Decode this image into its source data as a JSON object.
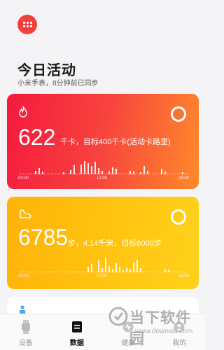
{
  "header": {
    "title": "今日活动",
    "sync_status": "小米手表，8分钟前已同步"
  },
  "calorie_card": {
    "value": "622",
    "detail": "千卡，目标400千卡(活动卡路里)",
    "axis_labels": [
      "00:00",
      "12:00",
      "24:00"
    ],
    "accent": "#f5193e",
    "hourly_levels": [
      0,
      0,
      0,
      0,
      0.2,
      0.35,
      0.15,
      0,
      0,
      0,
      0,
      0,
      0.1,
      0,
      0.25,
      0.5,
      0,
      0.55,
      0.75,
      0.6,
      0.45,
      0.7,
      0.35,
      0.2,
      0,
      0.15,
      0.4,
      0.3,
      0,
      0,
      0,
      0.2,
      0.15,
      0,
      0.1,
      0.45,
      0.2,
      0,
      0,
      0,
      0.3,
      0.15,
      0,
      0,
      0,
      0,
      0.1,
      0
    ]
  },
  "steps_card": {
    "value": "6785",
    "detail": "步，4.14千米，目标6000步",
    "axis_labels": [
      "00:00",
      "12:00",
      "24:00"
    ],
    "accent": "#ffb308",
    "hourly_levels": [
      0,
      0,
      0,
      0,
      0,
      0,
      0,
      0,
      0,
      0,
      0,
      0,
      0,
      0,
      0,
      0,
      0,
      0,
      0,
      0.3,
      0.45,
      0,
      0.65,
      0.25,
      0.8,
      0.35,
      0.2,
      0.5,
      0.3,
      0.15,
      0.25,
      0.2,
      0.55,
      0.7,
      0.25,
      0,
      0,
      0,
      0,
      0,
      0,
      0.2,
      0.15,
      0,
      0,
      0,
      0,
      0
    ]
  },
  "tabbar": {
    "tabs": [
      {
        "label": "设备",
        "icon": "watch-icon",
        "active": false
      },
      {
        "label": "数据",
        "icon": "data-icon",
        "active": true
      },
      {
        "label": "健康",
        "icon": "health-icon",
        "active": false
      },
      {
        "label": "我的",
        "icon": "profile-icon",
        "active": false
      }
    ]
  },
  "watermark": {
    "brand": "当下软件园",
    "url": "www.downxia.com"
  }
}
